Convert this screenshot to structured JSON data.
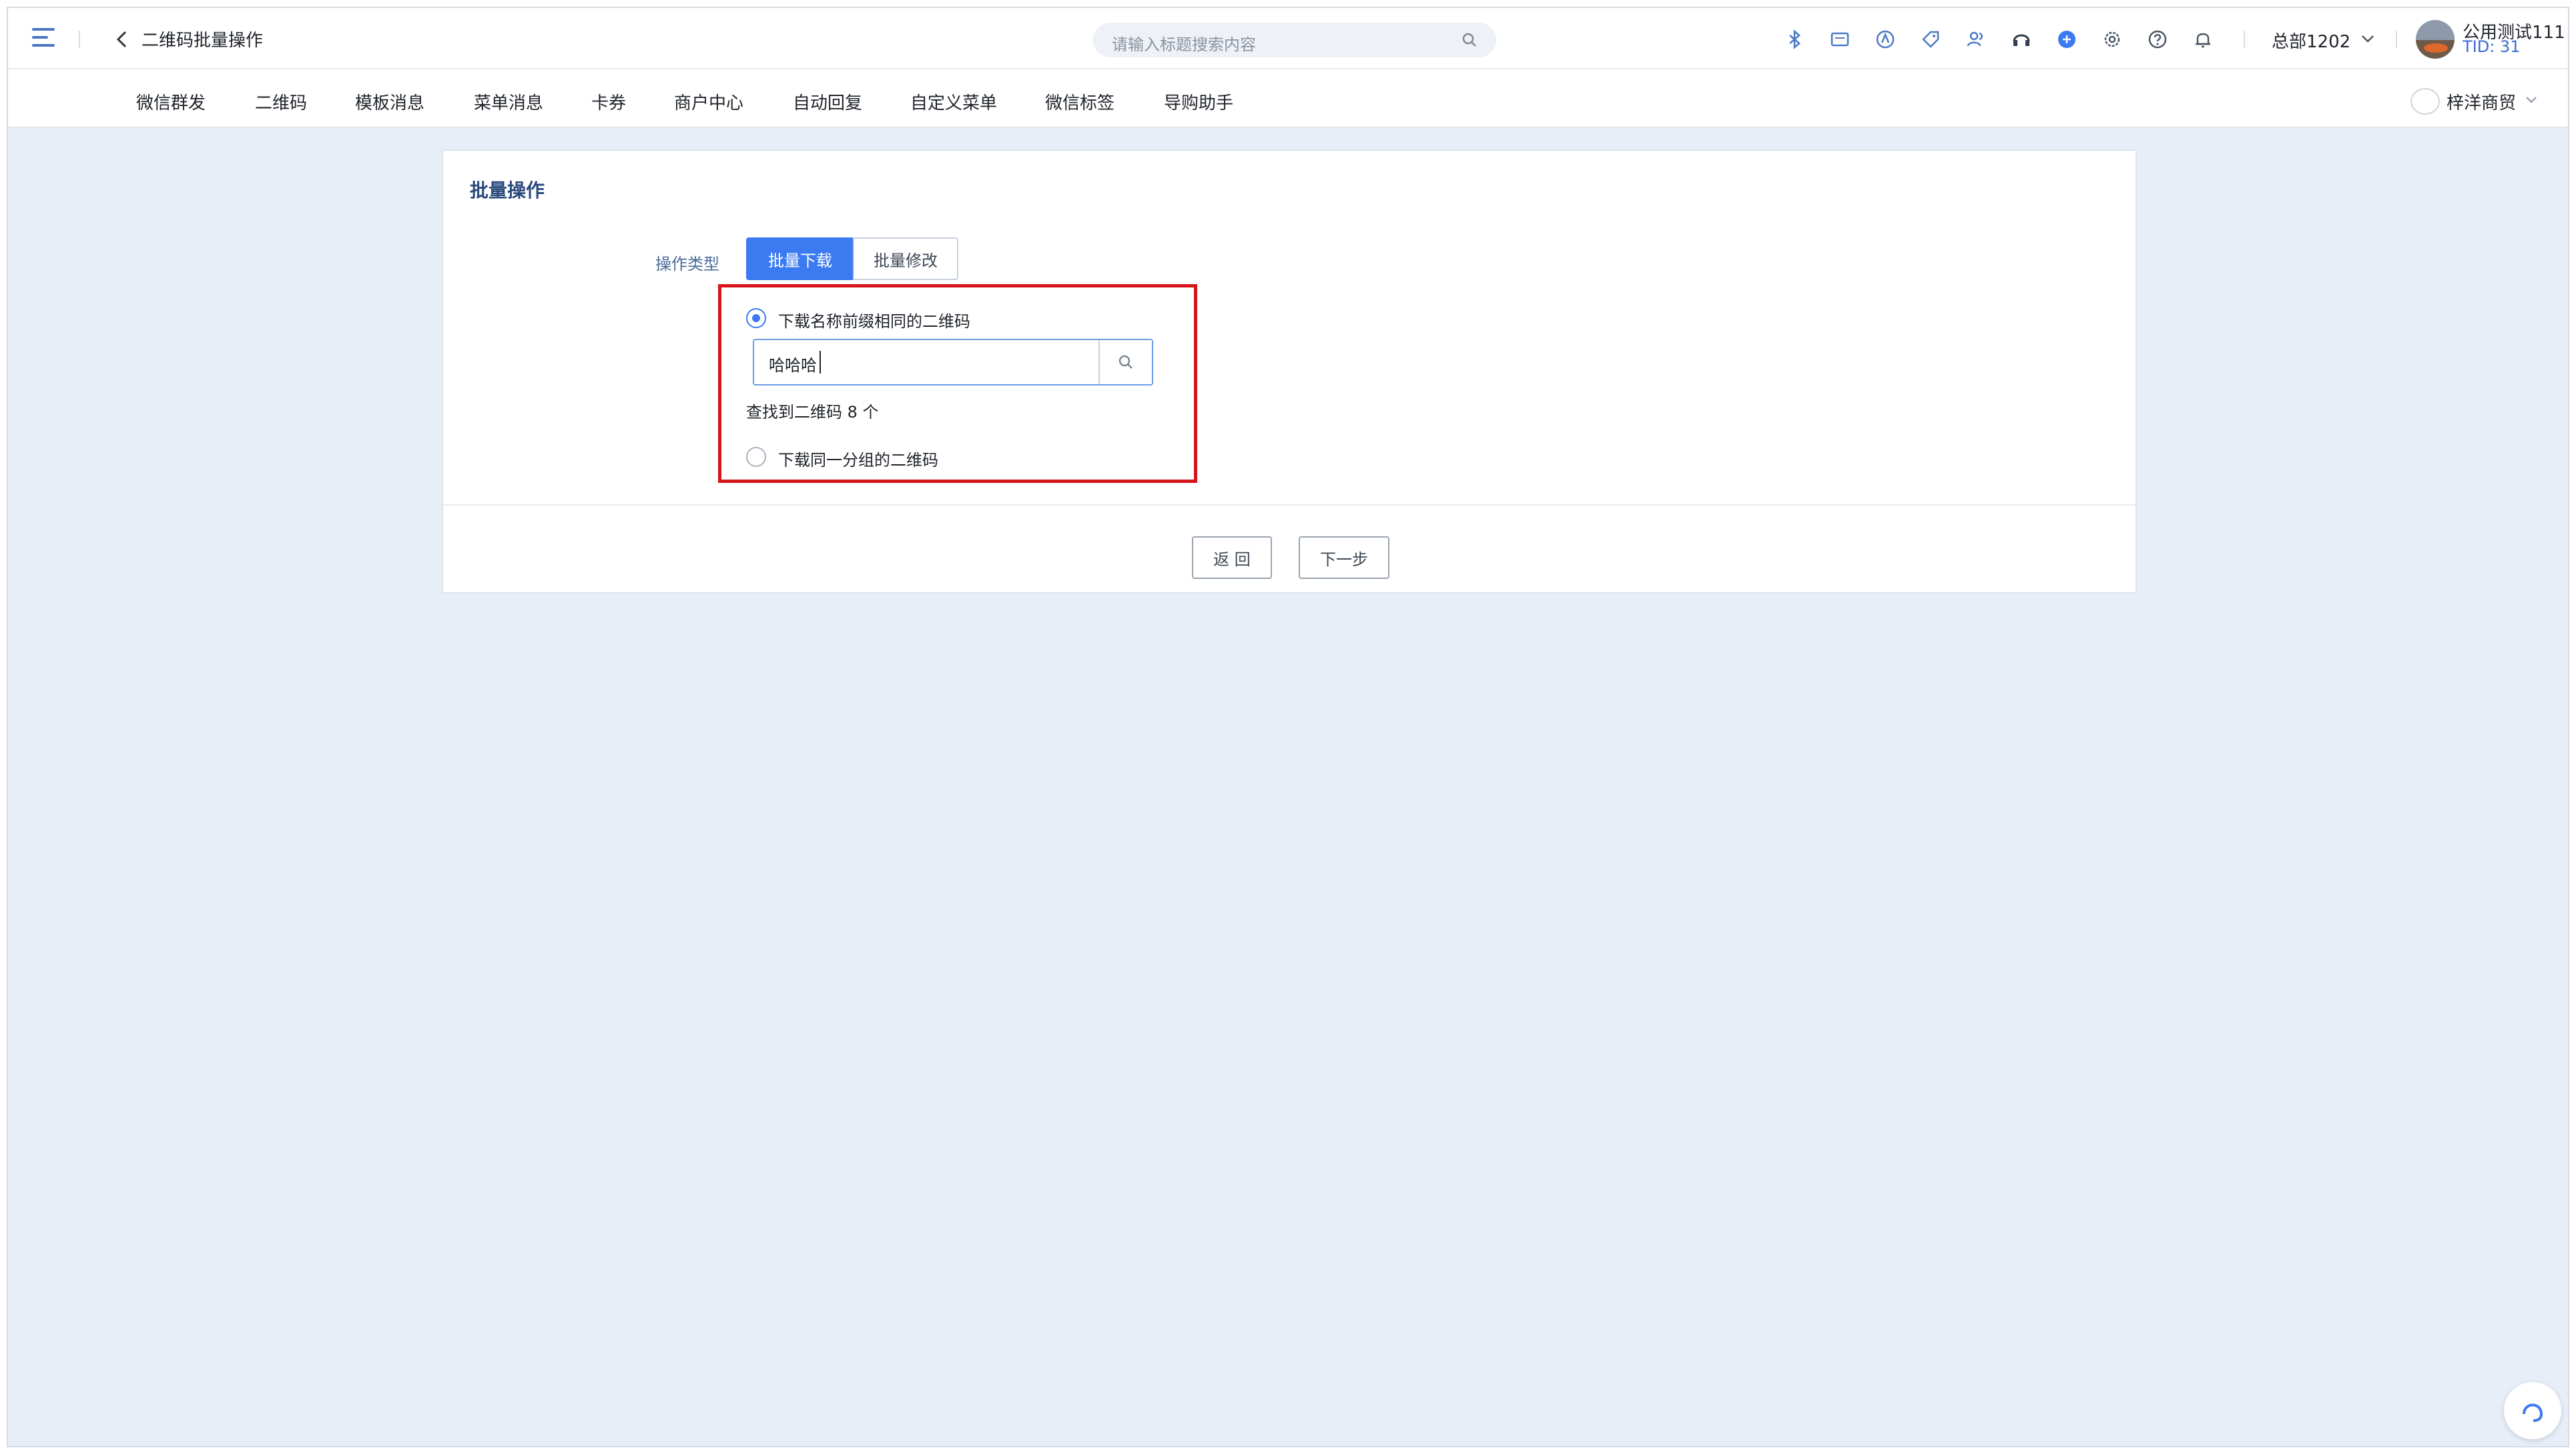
{
  "topbar": {
    "page_title": "二维码批量操作",
    "search_placeholder": "请输入标题搜索内容",
    "org": "总部1202",
    "user_name": "公用测试111",
    "user_tid": "TID: 31"
  },
  "nav": {
    "items": [
      "微信群发",
      "二维码",
      "模板消息",
      "菜单消息",
      "卡券",
      "商户中心",
      "自动回复",
      "自定义菜单",
      "微信标签",
      "导购助手"
    ],
    "shop_name": "梓洋商贸"
  },
  "card": {
    "title": "批量操作",
    "op_label": "操作类型",
    "tabs": [
      "批量下载",
      "批量修改"
    ],
    "option1_label": "下载名称前缀相同的二维码",
    "prefix_value": "哈哈哈",
    "found_text": "查找到二维码 8 个",
    "option2_label": "下载同一分组的二维码",
    "back_label": "返 回",
    "next_label": "下一步"
  },
  "colors": {
    "accent": "#3b7af0",
    "highlight_border": "#d6141c",
    "page_bg": "#e7eef8"
  }
}
